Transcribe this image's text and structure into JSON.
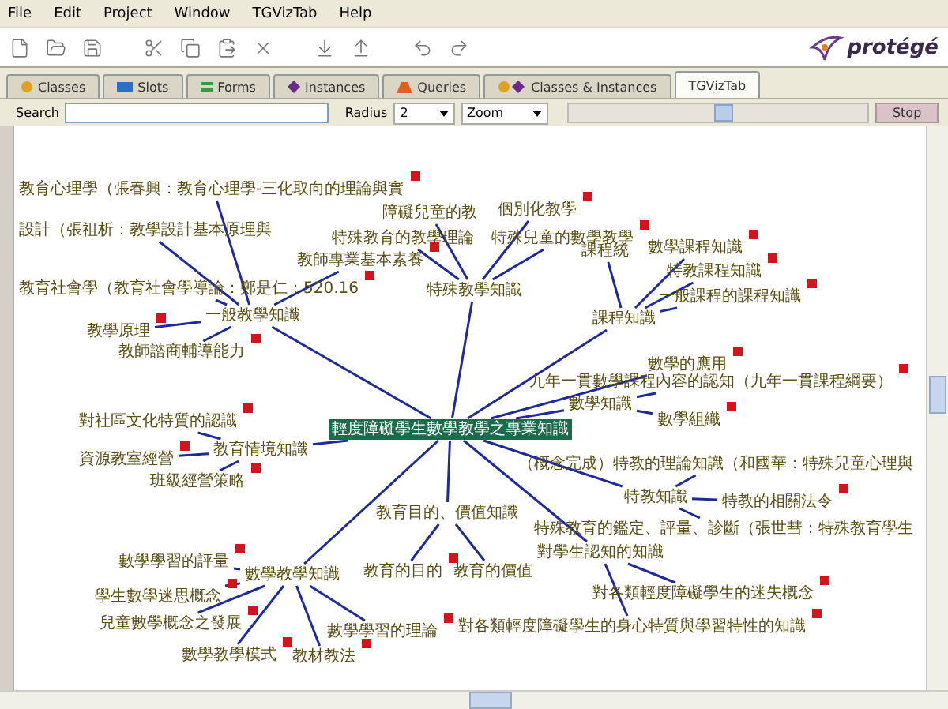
{
  "menu": [
    "File",
    "Edit",
    "Project",
    "Window",
    "TGVizTab",
    "Help"
  ],
  "logo": {
    "text": "protégé"
  },
  "tabs": [
    {
      "label": "Classes",
      "selected": false
    },
    {
      "label": "Slots",
      "selected": false
    },
    {
      "label": "Forms",
      "selected": false
    },
    {
      "label": "Instances",
      "selected": false
    },
    {
      "label": "Queries",
      "selected": false
    },
    {
      "label": "Classes & Instances",
      "selected": false
    },
    {
      "label": "TGVizTab",
      "selected": true
    }
  ],
  "controls": {
    "search_label": "Search",
    "radius_label": "Radius",
    "radius_value": "2",
    "zoom_value": "Zoom",
    "zoom_slider": {
      "level": 0.52
    },
    "stop_button": "Stop"
  },
  "graph": {
    "label": "輕度障礙學生數學教學之專業知識",
    "selected": true,
    "note": false,
    "children": [
      {
        "label": "一般教學知識",
        "selected": false,
        "note": false,
        "children": [
          {
            "label": "教育心理學（張春興：教育心理學-三化取向的理論與實",
            "selected": false,
            "note": true
          },
          {
            "label": "設計（張祖析：教學設計基本原理與",
            "selected": false,
            "note": false
          },
          {
            "label": "教師專業基本素養",
            "selected": false,
            "note": true
          },
          {
            "label": "教育社會學（教育社會學導論：鄭是仁：520.16",
            "selected": false,
            "note": true
          },
          {
            "label": "教學原理",
            "selected": false,
            "note": true
          },
          {
            "label": "教師諮商輔導能力",
            "selected": false,
            "note": true
          }
        ]
      },
      {
        "label": "特殊教學知識",
        "selected": false,
        "note": false,
        "children": [
          {
            "label": "障礙兒童的教",
            "selected": false,
            "note": false
          },
          {
            "label": "個別化教學",
            "selected": false,
            "note": true
          },
          {
            "label": "特殊教育的教學理論",
            "selected": false,
            "note": false
          },
          {
            "label": "特殊兒童的數學教學",
            "selected": false,
            "note": true
          }
        ]
      },
      {
        "label": "課程知識",
        "selected": false,
        "note": false,
        "children": [
          {
            "label": "課程統",
            "selected": false,
            "note": false
          },
          {
            "label": "數學課程知識",
            "selected": false,
            "note": true
          },
          {
            "label": "特教課程知識",
            "selected": false,
            "note": true
          },
          {
            "label": "一般課程的課程知識",
            "selected": false,
            "note": true
          }
        ]
      },
      {
        "label": "數學的應用",
        "selected": false,
        "note": true
      },
      {
        "label": "數學知識",
        "selected": false,
        "note": false,
        "children": [
          {
            "label": "九年一貫數學課程內容的認知（九年一貫課程綱要）",
            "selected": false,
            "note": true
          },
          {
            "label": "數學組織",
            "selected": false,
            "note": true
          }
        ]
      },
      {
        "label": "教育情境知識",
        "selected": false,
        "note": false,
        "children": [
          {
            "label": "對社區文化特質的認識",
            "selected": false,
            "note": true
          },
          {
            "label": "資源教室經營",
            "selected": false,
            "note": true
          },
          {
            "label": "班級經營策略",
            "selected": false,
            "note": true
          }
        ]
      },
      {
        "label": "特教知識",
        "selected": false,
        "note": false,
        "children": [
          {
            "label": "（概念完成）特教的理論知識（和國華：特殊兒童心理與",
            "selected": false,
            "note": false
          },
          {
            "label": "特教的相關法令",
            "selected": false,
            "note": true
          },
          {
            "label": "特殊教育的鑑定、評量、診斷（張世彗：特殊教育學生",
            "selected": false,
            "note": false
          }
        ]
      },
      {
        "label": "教育目的、價值知識",
        "selected": false,
        "note": false,
        "children": [
          {
            "label": "教育的目的",
            "selected": false,
            "note": true
          },
          {
            "label": "教育的價值",
            "selected": false,
            "note": false
          }
        ]
      },
      {
        "label": "對學生認知的知識",
        "selected": false,
        "note": false,
        "children": [
          {
            "label": "對各類輕度障礙學生的迷失概念",
            "selected": false,
            "note": true
          },
          {
            "label": "對各類輕度障礙學生的身心特質與學習特性的知識",
            "selected": false,
            "note": true
          }
        ]
      },
      {
        "label": "數學教學知識",
        "selected": false,
        "note": false,
        "children": [
          {
            "label": "數學學習的評量",
            "selected": false,
            "note": true
          },
          {
            "label": "學生數學迷思概念",
            "selected": false,
            "note": true
          },
          {
            "label": "兒童數學概念之發展",
            "selected": false,
            "note": true
          },
          {
            "label": "數學學習的理論",
            "selected": false,
            "note": true
          },
          {
            "label": "數學教學模式",
            "selected": false,
            "note": true
          },
          {
            "label": "教材教法",
            "selected": false,
            "note": true
          }
        ]
      }
    ]
  }
}
